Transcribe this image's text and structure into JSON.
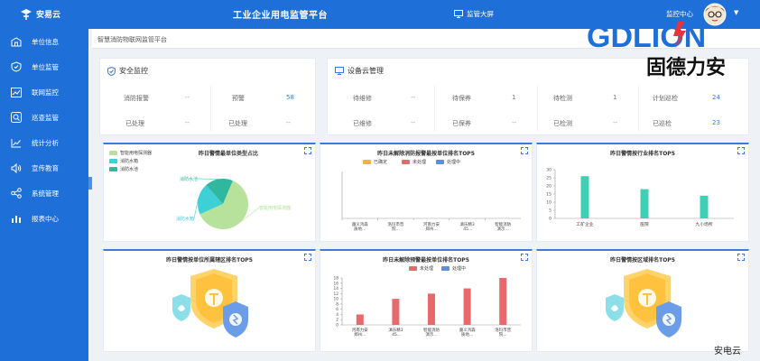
{
  "app": {
    "logo_name": "安易云",
    "system_title": "工业企业用电监管平台",
    "big_screen_label": "监管大屏",
    "monitor_center_label": "监控中心"
  },
  "sidebar": {
    "items": [
      {
        "label": "单位信息",
        "icon": "building-icon"
      },
      {
        "label": "单位监管",
        "icon": "shield-icon"
      },
      {
        "label": "联网监控",
        "icon": "chart-monitor-icon"
      },
      {
        "label": "巡查监管",
        "icon": "search-icon"
      },
      {
        "label": "统计分析",
        "icon": "trend-icon"
      },
      {
        "label": "宣传教育",
        "icon": "speaker-icon"
      },
      {
        "label": "系统管理",
        "icon": "share-icon"
      },
      {
        "label": "报表中心",
        "icon": "bar-chart-icon"
      }
    ]
  },
  "breadcrumb": "智慧消防物联网监管平台",
  "safety": {
    "title": "安全监控",
    "stats": [
      {
        "label": "消防报警",
        "value": "--"
      },
      {
        "label": "预警",
        "value": "58"
      },
      {
        "label": "已处理",
        "value": "--"
      },
      {
        "label": "已处理",
        "value": "--"
      }
    ]
  },
  "device": {
    "title": "设备云管理",
    "stats": [
      {
        "label": "待维修",
        "value": "--"
      },
      {
        "label": "待保养",
        "value": "1"
      },
      {
        "label": "待检测",
        "value": "1"
      },
      {
        "label": "计划巡检",
        "value": "24"
      },
      {
        "label": "已维修",
        "value": "--"
      },
      {
        "label": "已保养",
        "value": "--"
      },
      {
        "label": "已检测",
        "value": "--"
      },
      {
        "label": "已巡检",
        "value": "23"
      }
    ]
  },
  "charts": {
    "pie_title": "昨日警情最单位类型占比",
    "top5_fire_title": "昨日未解除消防报警最按单位排名TOP5",
    "industry_title": "昨日警情按行业排名TOP5",
    "fire_region_title": "昨日警情按单位所属辖区排名TOP5",
    "warning_unit_title": "昨日未解除预警最按单位排名TOP5",
    "warning_region_title": "昨日警情按区域排名TOP5"
  },
  "chart_data": [
    {
      "type": "pie",
      "title": "昨日警情最单位类型占比",
      "legend": [
        "智能用电探测器",
        "消防水箱",
        "消防水池"
      ],
      "slices": [
        {
          "name": "智能用电探测器",
          "value": 62,
          "color": "#b6e29b"
        },
        {
          "name": "消防水箱",
          "value": 20,
          "color": "#3ed0d7"
        },
        {
          "name": "消防水池",
          "value": 18,
          "color": "#2fb7a0"
        }
      ],
      "slice_labels": [
        "智能用电探测器",
        "消防水箱",
        "消防水池"
      ]
    },
    {
      "type": "bar",
      "title": "昨日未解除消防报警最按单位排名TOP5",
      "legend": [
        "已确定",
        "未处理",
        "处理中"
      ],
      "legend_colors": [
        "#f0b72f",
        "#e8696b",
        "#5b8fde"
      ],
      "categories": [
        "遵义鸿森质地...",
        "洛玛市普院...",
        "河南力安郑州...",
        "滇乐精3 45...",
        "智能消防演示..."
      ],
      "values": []
    },
    {
      "type": "bar",
      "title": "昨日警情按行业排名TOP5",
      "categories": [
        "工矿企业",
        "医院",
        "九小场所"
      ],
      "values": [
        26,
        18,
        14
      ],
      "ylim": [
        0,
        30
      ],
      "yticks": [
        "0",
        "5",
        "10",
        "15",
        "20",
        "25",
        "30"
      ],
      "color": "#3ecfb4"
    },
    {
      "type": "bar",
      "title": "昨日未解除预警最按单位排名TOP5",
      "legend": [
        "未处理",
        "处理中"
      ],
      "legend_colors": [
        "#e8696b",
        "#5b8fde"
      ],
      "categories": [
        "河南力安郑州...",
        "滇乐精3 45...",
        "智能消防演示...",
        "遵义鸿森质地...",
        "洛玛市普院..."
      ],
      "values": [
        4,
        10,
        12,
        14,
        18
      ],
      "ylim": [
        0,
        18
      ],
      "yticks": [
        "0",
        "2",
        "4",
        "6",
        "8",
        "10",
        "12",
        "14",
        "16",
        "18"
      ],
      "color": "#e8696b"
    }
  ],
  "watermark": {
    "brand_text": "GDLION",
    "brand_cn": "固德力安",
    "corner_text": "安电云"
  }
}
